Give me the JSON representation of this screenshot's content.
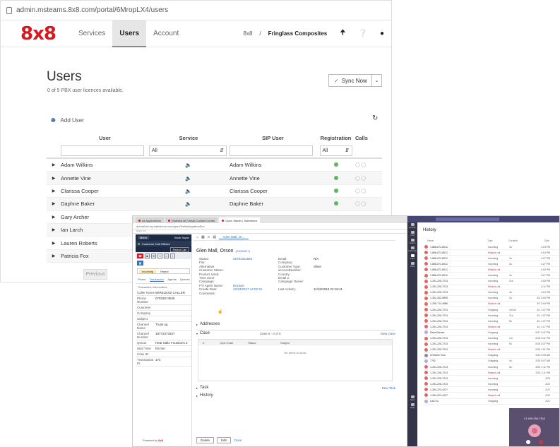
{
  "browser": {
    "url": "admin.msteams.8x8.com/portal/6MropLX4/users"
  },
  "nav": {
    "logo": "8x8",
    "items": [
      "Services",
      "Users",
      "Account"
    ],
    "active": "Users",
    "brand": "8x8",
    "separator": "/",
    "company": "Fringlass Composites"
  },
  "page": {
    "title": "Users",
    "licenses": "0 of 5 PBX user licences available.",
    "sync_label": "Sync Now",
    "add_user": "Add User",
    "prev_label": "Previous"
  },
  "table": {
    "headers": {
      "user": "User",
      "service": "Service",
      "sip": "SIP User",
      "registration": "Registration",
      "calls": "Calls"
    },
    "service_filter": "All",
    "registration_filter": "All",
    "rows": [
      {
        "user": "Adam Wilkins",
        "sip": "Adam Wilkins",
        "has_sip": true
      },
      {
        "user": "Annette Vine",
        "sip": "Annette Vine",
        "has_sip": true
      },
      {
        "user": "Clarissa Cooper",
        "sip": "Clarissa Cooper",
        "has_sip": true
      },
      {
        "user": "Daphne Baker",
        "sip": "Daphne Baker",
        "has_sip": true
      },
      {
        "user": "Gary Archer",
        "sip": "",
        "has_sip": false
      },
      {
        "user": "Ian Larch",
        "sip": "",
        "has_sip": false
      },
      {
        "user": "Lauren Roberts",
        "sip": "",
        "has_sip": false
      },
      {
        "user": "Patricia Fox",
        "sip": "",
        "has_sip": false
      }
    ]
  },
  "crm": {
    "tabs": [
      "All Applications",
      "[Salesforce] Virtual Contact Center",
      "Open Starter | Salesforce"
    ],
    "address": "dorrsehell.my.salesforce.com/apex/SafeIntegrationShv",
    "bookmarks": "Apps  lmi",
    "agent_panel": {
      "menu": "Menu",
      "agent_status": "Work Super",
      "status": "Customer Call Offered",
      "reject": "Reject Call",
      "accept_label": "Incoming",
      "accept_btn": "Reject",
      "tabs": [
        "Phone",
        "Transaction",
        "Agents",
        "Queues"
      ],
      "active_tab": "Transaction",
      "section_title": "Transaction Information",
      "fields": [
        {
          "k": "Caller Name",
          "v": "WIRELESS CALLER"
        },
        {
          "k": "Phone Number",
          "v": "07933574845"
        },
        {
          "k": "Customer",
          "v": ""
        },
        {
          "k": "Company",
          "v": ""
        },
        {
          "k": "Subject",
          "v": ""
        },
        {
          "k": "Channel Name",
          "v": "Trunk.sg"
        },
        {
          "k": "Channel Number",
          "v": "18772373347"
        },
        {
          "k": "Queue",
          "v": "Heat Saltz Fountions 2"
        },
        {
          "k": "Wait Time",
          "v": "hh:mm"
        },
        {
          "k": "Case ID",
          "v": ""
        },
        {
          "k": "Transaction ID",
          "v": "174"
        }
      ],
      "powered_by": "Powered by",
      "powered_brand": "8x8"
    },
    "record": {
      "tab": "Glen Mall, Or...",
      "name": "Glen Mall, Orson",
      "id": "(03050917)",
      "fields": [
        {
          "a": "Status:",
          "b": "02794311864",
          "c": "Email:",
          "d": "N/A"
        },
        {
          "a": "Fax:",
          "b": "",
          "c": "Company:",
          "d": ""
        },
        {
          "a": "Alternative:",
          "b": "",
          "c": "Customer Type:",
          "d": "Silver"
        },
        {
          "a": "Customer Status:",
          "b": "",
          "c": "accountNumber:",
          "d": ""
        },
        {
          "a": "Product Used:",
          "b": "",
          "c": "Country:",
          "d": ""
        },
        {
          "a": "Time Zone:",
          "b": "",
          "c": "Email 2:",
          "d": ""
        },
        {
          "a": "Campaign:",
          "b": "",
          "c": "Campaign Owner:",
          "d": ""
        },
        {
          "a": "FTI Agent Name:",
          "b": "Decarte",
          "c": "",
          "d": ""
        },
        {
          "a": "Create Date:",
          "b": "10/23/2017 14:02:31",
          "c": "Last Activity:",
          "d": "11/18/2018 22:18:41"
        },
        {
          "a": "Comments:",
          "b": "",
          "c": "",
          "d": ""
        }
      ],
      "addresses": "Addresses",
      "case": "Case",
      "case_pager": "Case 0 - 0 of 0",
      "new_case": "New Case",
      "case_headers": [
        "#",
        "Open Date",
        "Status",
        "Subject"
      ],
      "no_items": "No Items to show",
      "task": "Task",
      "new_task": "New Task",
      "history": "History",
      "delete_btn": "Delete",
      "edit_btn": "Edit",
      "close_link": "Close"
    }
  },
  "teams": {
    "title": "History",
    "headers": [
      "Name",
      "Type",
      "Duration",
      "Date"
    ],
    "rail": [
      "Activity",
      "Chat",
      "Teams",
      "Calendar",
      "Calls",
      "Files",
      "Apps",
      "Help"
    ],
    "rows": [
      {
        "name": "1-888-672-8012",
        "type": "Incoming",
        "dur": "4s",
        "date": "4:23 PM",
        "av": "r"
      },
      {
        "name": "1-888-672-8012",
        "type": "Missed call",
        "dur": "",
        "date": "4:19 PM",
        "av": "r"
      },
      {
        "name": "1-888-672-8012",
        "type": "Incoming",
        "dur": "1s",
        "date": "4:27 PM",
        "av": "r"
      },
      {
        "name": "1-888-672-8012",
        "type": "Incoming",
        "dur": "2s",
        "date": "4:27 PM",
        "av": "r"
      },
      {
        "name": "1-888-672-8012",
        "type": "Missed call",
        "dur": "",
        "date": "4:18 PM",
        "av": "r"
      },
      {
        "name": "1-888-672-8012",
        "type": "Incoming",
        "dur": "1s",
        "date": "3:17 PM",
        "av": "r"
      },
      {
        "name": "1-251-226-7213",
        "type": "Incoming",
        "dur": "11s",
        "date": "4:18 PM",
        "av": "r"
      },
      {
        "name": "1-251-226-7213",
        "type": "Missed call",
        "dur": "",
        "date": "4:11 PM",
        "av": "r"
      },
      {
        "name": "1-251-226-7213",
        "type": "Incoming",
        "dur": "4s",
        "date": "4:14 PM",
        "av": "r"
      },
      {
        "name": "1-362-362-5895",
        "type": "Incoming",
        "dur": "2s",
        "date": "3/2 3:04 PM",
        "av": "r"
      },
      {
        "name": "1-255-714-4886",
        "type": "Missed call",
        "dur": "",
        "date": "3/2 2:04 PM",
        "av": "r"
      },
      {
        "name": "1-251-226-7213",
        "type": "Outgoing",
        "dur": "1m 5s",
        "date": "3/1 1:07 PM",
        "av": "r"
      },
      {
        "name": "1-251-226-7213",
        "type": "Incoming",
        "dur": "11s",
        "date": "3/1 1:07 PM",
        "av": "r"
      },
      {
        "name": "1-251-226-7213",
        "type": "Incoming",
        "dur": "5s",
        "date": "3/1 1:07 PM",
        "av": "r"
      },
      {
        "name": "1-251-226-7213",
        "type": "Missed call",
        "dur": "",
        "date": "3/1 1:17 PM",
        "av": "r"
      },
      {
        "name": "Dana Barnes",
        "type": "Outgoing",
        "dur": "",
        "date": "2/27 3:47 PM",
        "av": "p"
      },
      {
        "name": "1-251-226-7213",
        "type": "Incoming",
        "dur": "1m",
        "date": "2/26 3:41 PM",
        "av": "r"
      },
      {
        "name": "1-251-226-7213",
        "type": "Incoming",
        "dur": "5s",
        "date": "2/26 3:37 PM",
        "av": "r"
      },
      {
        "name": "1-251-226-7213",
        "type": "Missed call",
        "dur": "",
        "date": "2/26 1:01 PM",
        "av": "r"
      },
      {
        "name": "Christine Chui",
        "type": "Outgoing",
        "dur": "",
        "date": "2/24 9:09 AM",
        "av": "g"
      },
      {
        "name": "7782",
        "type": "Outgoing",
        "dur": "4s",
        "date": "2/24 9:07 AM",
        "av": "p"
      },
      {
        "name": "1-251-226-7213",
        "type": "Incoming",
        "dur": "6s",
        "date": "2/23 1:11 PM",
        "av": "r"
      },
      {
        "name": "1-251-226-7213",
        "type": "Missed call",
        "dur": "",
        "date": "2/23 1:11 PM",
        "av": "r"
      },
      {
        "name": "1-251-226-7213",
        "type": "Incoming",
        "dur": "",
        "date": "2/23",
        "av": "r"
      },
      {
        "name": "1-251-226-7213",
        "type": "Incoming",
        "dur": "",
        "date": "2/22",
        "av": "r"
      },
      {
        "name": "1-284-223-4227",
        "type": "Incoming",
        "dur": "",
        "date": "2/22",
        "av": "r"
      },
      {
        "name": "1-284-223-4227",
        "type": "Missed call",
        "dur": "",
        "date": "2/22",
        "av": "r"
      },
      {
        "name": "Lisa Su",
        "type": "Outgoing",
        "dur": "",
        "date": "2/21",
        "av": "p"
      }
    ],
    "call_toast": "+1 409-294-7512"
  }
}
